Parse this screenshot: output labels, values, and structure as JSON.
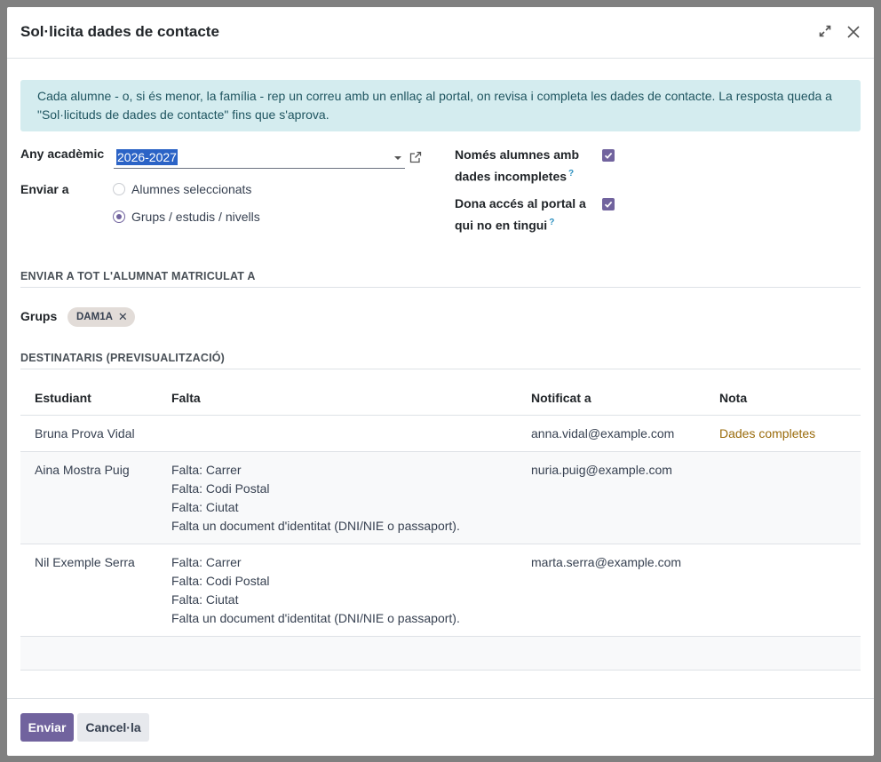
{
  "dialog": {
    "title": "Sol·licita dades de contacte"
  },
  "alert": {
    "text": "Cada alumne - o, si és menor, la família - rep un correu amb un enllaç al portal, on revisa i completa les dades de contacte. La resposta queda a \"Sol·licituds de dades de contacte\" fins que s'aprova."
  },
  "form": {
    "academic_year_label": "Any acadèmic",
    "academic_year_value": "2026-2027",
    "send_to_label": "Enviar a",
    "send_to_options": [
      {
        "label": "Alumnes seleccionats",
        "selected": false
      },
      {
        "label": "Grups / estudis / nivells",
        "selected": true
      }
    ],
    "only_incomplete_label_1": "Només alumnes amb",
    "only_incomplete_label_2": "dades incompletes",
    "only_incomplete_checked": true,
    "portal_access_label_1": "Dona accés al portal a",
    "portal_access_label_2": "qui no en tingui",
    "portal_access_checked": true,
    "help_mark": "?"
  },
  "section_send_all": {
    "title": "ENVIAR A TOT L'ALUMNAT MATRICULAT A",
    "groups_label": "Grups",
    "groups": [
      "DAM1A"
    ]
  },
  "section_recipients": {
    "title": "DESTINATARIS (PREVISUALITZACIÓ)",
    "columns": [
      "Estudiant",
      "Falta",
      "Notificat a",
      "Nota"
    ],
    "rows": [
      {
        "student": "Bruna Prova Vidal",
        "missing": [],
        "notified": "anna.vidal@example.com",
        "note": "Dades completes"
      },
      {
        "student": "Aina Mostra Puig",
        "missing": [
          "Falta: Carrer",
          "Falta: Codi Postal",
          "Falta: Ciutat",
          "Falta un document d'identitat (DNI/NIE o passaport)."
        ],
        "notified": "nuria.puig@example.com",
        "note": ""
      },
      {
        "student": "Nil Exemple Serra",
        "missing": [
          "Falta: Carrer",
          "Falta: Codi Postal",
          "Falta: Ciutat",
          "Falta un document d'identitat (DNI/NIE o passaport)."
        ],
        "notified": "marta.serra@example.com",
        "note": ""
      }
    ]
  },
  "footer": {
    "send_label": "Enviar",
    "cancel_label": "Cancel·la"
  },
  "colors": {
    "primary": "#71639e",
    "alert_bg": "#d4ecef",
    "note_color": "#9a6b0b"
  }
}
